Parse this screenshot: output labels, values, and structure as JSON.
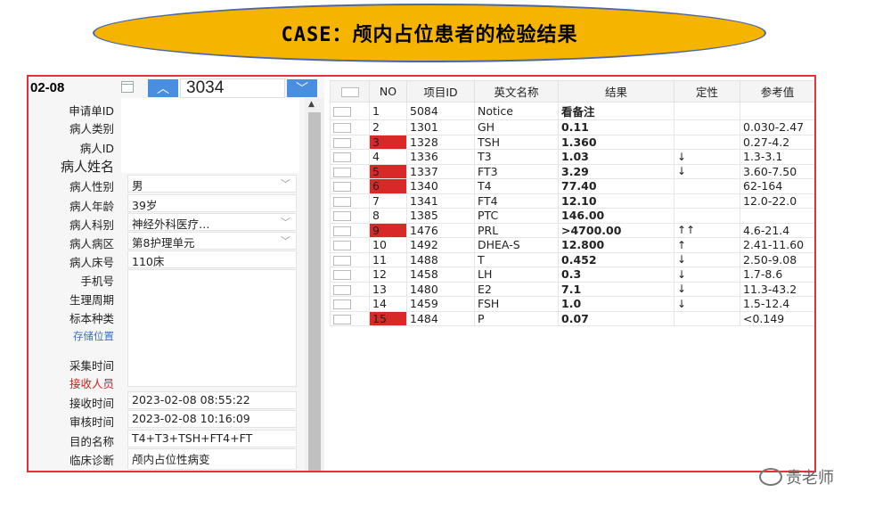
{
  "title": "CASE：颅内占位患者的检验结果",
  "left_panel": {
    "date": "02-08",
    "request_number": "3034",
    "labels": {
      "request_id": "申请单ID",
      "patient_type": "病人类别",
      "patient_id": "病人ID",
      "patient_name": "病人姓名",
      "gender": "病人性别",
      "age": "病人年龄",
      "department": "病人科别",
      "ward": "病人病区",
      "bed": "病人床号",
      "phone": "手机号",
      "cycle": "生理周期",
      "specimen": "标本种类",
      "storage": "存储位置",
      "collect_time": "采集时间",
      "receiver": "接收人员",
      "receive_time": "接收时间",
      "review_time": "审核时间",
      "purpose": "目的名称",
      "diagnosis": "临床诊断"
    },
    "values": {
      "gender": "男",
      "age": "39岁",
      "department": "神经外科医疗…",
      "ward": "第8护理单元",
      "bed": "110床",
      "receive_time": "2023-02-08 08:55:22",
      "review_time": "2023-02-08 10:16:09",
      "purpose": "T4+T3+TSH+FT4+FT",
      "diagnosis": "颅内占位性病变"
    },
    "icons": [
      "calendar-icon",
      "chevron-up-icon",
      "chevron-down-icon"
    ]
  },
  "table": {
    "headers": [
      "NO",
      "项目ID",
      "英文名称",
      "结果",
      "定性",
      "参考值"
    ],
    "rows": [
      {
        "no": "1",
        "id": "5084",
        "name": "Notice",
        "result": "看备注",
        "qual": "",
        "ref": "",
        "flag": false,
        "color": ""
      },
      {
        "no": "2",
        "id": "1301",
        "name": "GH",
        "result": "0.11",
        "qual": "",
        "ref": "0.030-2.47",
        "flag": false,
        "color": ""
      },
      {
        "no": "3",
        "id": "1328",
        "name": "TSH",
        "result": "1.360",
        "qual": "",
        "ref": "0.27-4.2",
        "flag": true,
        "color": ""
      },
      {
        "no": "4",
        "id": "1336",
        "name": "T3",
        "result": "1.03",
        "qual": "↓",
        "ref": "1.3-3.1",
        "flag": false,
        "color": "blue"
      },
      {
        "no": "5",
        "id": "1337",
        "name": "FT3",
        "result": "3.29",
        "qual": "↓",
        "ref": "3.60-7.50",
        "flag": true,
        "color": "blue"
      },
      {
        "no": "6",
        "id": "1340",
        "name": "T4",
        "result": "77.40",
        "qual": "",
        "ref": "62-164",
        "flag": true,
        "color": ""
      },
      {
        "no": "7",
        "id": "1341",
        "name": "FT4",
        "result": "12.10",
        "qual": "",
        "ref": "12.0-22.0",
        "flag": false,
        "color": ""
      },
      {
        "no": "8",
        "id": "1385",
        "name": "PTC",
        "result": "146.00",
        "qual": "",
        "ref": "",
        "flag": false,
        "color": ""
      },
      {
        "no": "9",
        "id": "1476",
        "name": "PRL",
        "result": ">4700.00",
        "qual": "↑↑",
        "ref": "4.6-21.4",
        "flag": true,
        "color": "green"
      },
      {
        "no": "10",
        "id": "1492",
        "name": "DHEA-S",
        "result": "12.800",
        "qual": "↑",
        "ref": "2.41-11.60",
        "flag": false,
        "color": "red"
      },
      {
        "no": "11",
        "id": "1488",
        "name": "T",
        "result": "0.452",
        "qual": "↓",
        "ref": "2.50-9.08",
        "flag": false,
        "color": "blue"
      },
      {
        "no": "12",
        "id": "1458",
        "name": "LH",
        "result": "0.3",
        "qual": "↓",
        "ref": "1.7-8.6",
        "flag": false,
        "color": "blue"
      },
      {
        "no": "13",
        "id": "1480",
        "name": "E2",
        "result": "7.1",
        "qual": "↓",
        "ref": "11.3-43.2",
        "flag": false,
        "color": "blue"
      },
      {
        "no": "14",
        "id": "1459",
        "name": "FSH",
        "result": "1.0",
        "qual": "↓",
        "ref": "1.5-12.4",
        "flag": false,
        "color": "blue"
      },
      {
        "no": "15",
        "id": "1484",
        "name": "P",
        "result": "0.07",
        "qual": "",
        "ref": "<0.149",
        "flag": true,
        "color": ""
      }
    ]
  },
  "watermark": "贵老师",
  "colors": {
    "title_bg": "#f5b400",
    "frame": "#e8303a",
    "button": "#4a8ee0",
    "flag": "#d92828"
  }
}
